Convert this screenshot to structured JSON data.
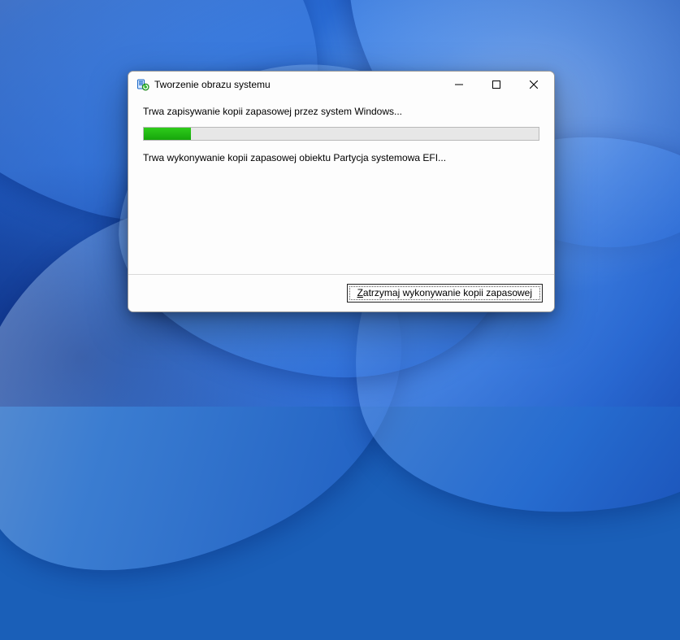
{
  "window": {
    "title": "Tworzenie obrazu systemu",
    "status_line": "Trwa zapisywanie kopii zapasowej przez system Windows...",
    "detail_line": "Trwa wykonywanie kopii zapasowej obiektu Partycja systemowa EFI...",
    "progress_percent": 12,
    "stop_button": {
      "mnemonic": "Z",
      "rest": "atrzymaj wykonywanie kopii zapasowej"
    }
  },
  "icons": {
    "app": "backup-restore-icon",
    "minimize": "minimize-icon",
    "maximize": "maximize-icon",
    "close": "close-icon"
  }
}
